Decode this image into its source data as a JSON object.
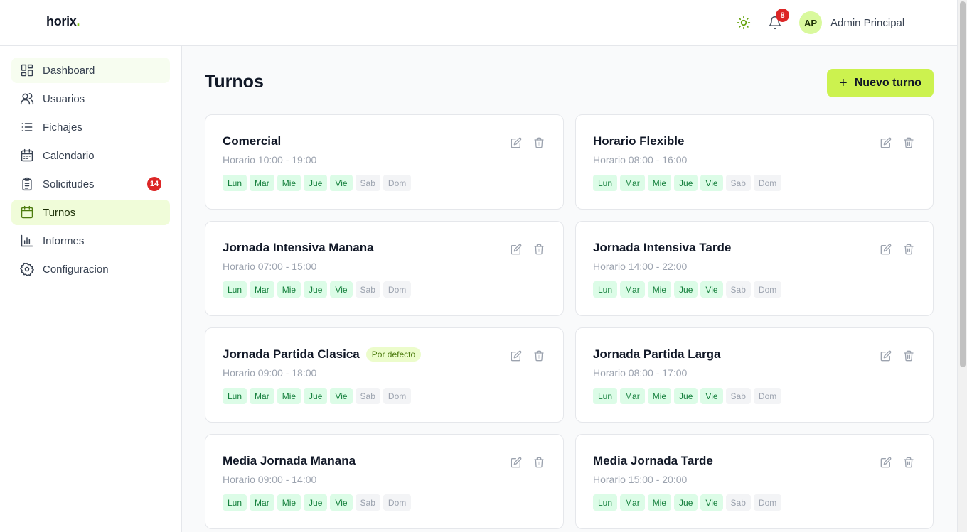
{
  "app": {
    "logo_text": "horix",
    "logo_dot": "."
  },
  "header": {
    "notifications_count": "8",
    "user": {
      "initials": "AP",
      "name": "Admin Principal"
    },
    "icons": {
      "theme": "sun-icon",
      "notifications": "bell-icon"
    }
  },
  "colors": {
    "accent": "#ccf24f",
    "active_bg": "#f0fcd9",
    "badge_red": "#dc2626",
    "day_on_bg": "#dcfce7",
    "day_on_text": "#15803d"
  },
  "sidebar": {
    "items": [
      {
        "label": "Dashboard",
        "icon": "dashboard-grid-icon"
      },
      {
        "label": "Usuarios",
        "icon": "users-icon"
      },
      {
        "label": "Fichajes",
        "icon": "list-icon"
      },
      {
        "label": "Calendario",
        "icon": "calendar-icon"
      },
      {
        "label": "Solicitudes",
        "icon": "clipboard-icon",
        "badge": "14"
      },
      {
        "label": "Turnos",
        "icon": "calendar-icon",
        "active": true
      },
      {
        "label": "Informes",
        "icon": "bar-chart-icon"
      },
      {
        "label": "Configuracion",
        "icon": "gear-icon"
      }
    ]
  },
  "main": {
    "title": "Turnos",
    "new_button_label": "Nuevo turno",
    "days": [
      "Lun",
      "Mar",
      "Mie",
      "Jue",
      "Vie",
      "Sab",
      "Dom"
    ],
    "shifts": [
      {
        "name": "Comercial",
        "hours": "Horario 10:00 - 19:00",
        "badge": "",
        "days_on": [
          true,
          true,
          true,
          true,
          true,
          false,
          false
        ]
      },
      {
        "name": "Horario Flexible",
        "hours": "Horario 08:00 - 16:00",
        "badge": "",
        "days_on": [
          true,
          true,
          true,
          true,
          true,
          false,
          false
        ]
      },
      {
        "name": "Jornada Intensiva Manana",
        "hours": "Horario 07:00 - 15:00",
        "badge": "",
        "days_on": [
          true,
          true,
          true,
          true,
          true,
          false,
          false
        ]
      },
      {
        "name": "Jornada Intensiva Tarde",
        "hours": "Horario 14:00 - 22:00",
        "badge": "",
        "days_on": [
          true,
          true,
          true,
          true,
          true,
          false,
          false
        ]
      },
      {
        "name": "Jornada Partida Clasica",
        "hours": "Horario 09:00 - 18:00",
        "badge": "Por defecto",
        "days_on": [
          true,
          true,
          true,
          true,
          true,
          false,
          false
        ]
      },
      {
        "name": "Jornada Partida Larga",
        "hours": "Horario 08:00 - 17:00",
        "badge": "",
        "days_on": [
          true,
          true,
          true,
          true,
          true,
          false,
          false
        ]
      },
      {
        "name": "Media Jornada Manana",
        "hours": "Horario 09:00 - 14:00",
        "badge": "",
        "days_on": [
          true,
          true,
          true,
          true,
          true,
          false,
          false
        ]
      },
      {
        "name": "Media Jornada Tarde",
        "hours": "Horario 15:00 - 20:00",
        "badge": "",
        "days_on": [
          true,
          true,
          true,
          true,
          true,
          false,
          false
        ]
      }
    ]
  }
}
